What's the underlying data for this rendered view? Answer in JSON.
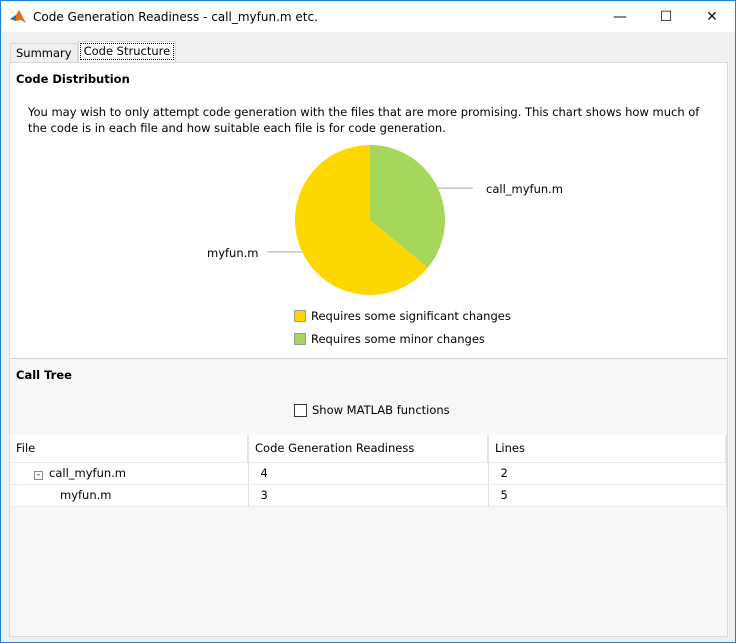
{
  "window": {
    "title": "Code Generation Readiness - call_myfun.m etc."
  },
  "tabs": [
    {
      "label": "Summary"
    },
    {
      "label": "Code Structure"
    }
  ],
  "distribution": {
    "heading": "Code Distribution",
    "description": "You may wish to only attempt code generation with the files that are more promising. This chart shows how much of the code is in each file and how suitable each file is for code generation.",
    "legend": [
      {
        "label": "Requires some significant changes",
        "color": "#ffd700"
      },
      {
        "label": "Requires some minor changes",
        "color": "#a6d65a"
      }
    ]
  },
  "chart_data": {
    "type": "pie",
    "slices": [
      {
        "label": "call_myfun.m",
        "fraction": 0.36,
        "color": "#a6d65a"
      },
      {
        "label": "myfun.m",
        "fraction": 0.64,
        "color": "#ffd700"
      }
    ]
  },
  "calltree": {
    "heading": "Call Tree",
    "checkbox_label": "Show MATLAB functions",
    "columns": [
      "File",
      "Code Generation Readiness",
      "Lines"
    ],
    "rows": [
      {
        "file": "call_myfun.m",
        "readiness": "4",
        "lines": "2"
      },
      {
        "file": "myfun.m",
        "readiness": "3",
        "lines": "5"
      }
    ]
  }
}
